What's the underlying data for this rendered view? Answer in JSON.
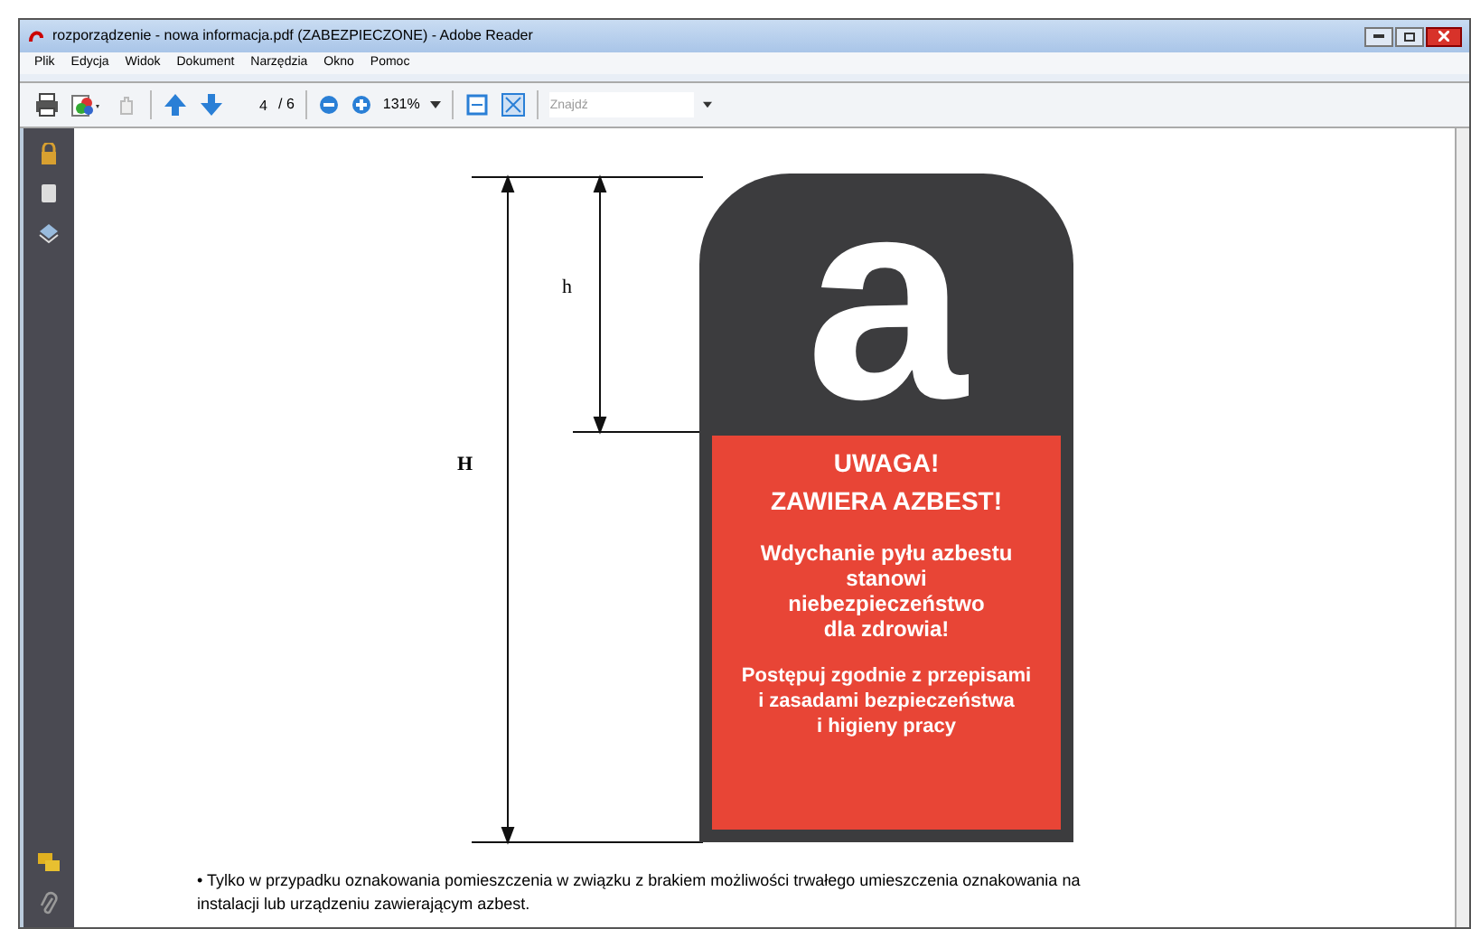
{
  "window": {
    "title": "rozporządzenie - nowa informacja.pdf (ZABEZPIECZONE) - Adobe Reader"
  },
  "menu": [
    "Plik",
    "Edycja",
    "Widok",
    "Dokument",
    "Narzędzia",
    "Okno",
    "Pomoc"
  ],
  "toolbar": {
    "page": "4",
    "page_count": "/ 6",
    "zoom": "131%",
    "search_placeholder": "Znajdź"
  },
  "document": {
    "dimension_labels": {
      "total": "H",
      "letter": "h"
    },
    "sign": {
      "letter": "a",
      "heading": [
        "UWAGA!",
        "ZAWIERA AZBEST!"
      ],
      "warning": "Wdychanie pyłu azbestu\nstanowi\nniebezpieczeństwo\ndla zdrowia!",
      "instruction": "Postępuj zgodnie z przepisami\ni zasadami bezpieczeństwa\ni higieny pracy"
    },
    "footnote": [
      "• Tylko w przypadku oznakowania pomieszczenia w związku z brakiem możliwości trwałego umieszczenia oznakowania na",
      "instalacji lub urządzeniu zawierającym azbest."
    ]
  }
}
